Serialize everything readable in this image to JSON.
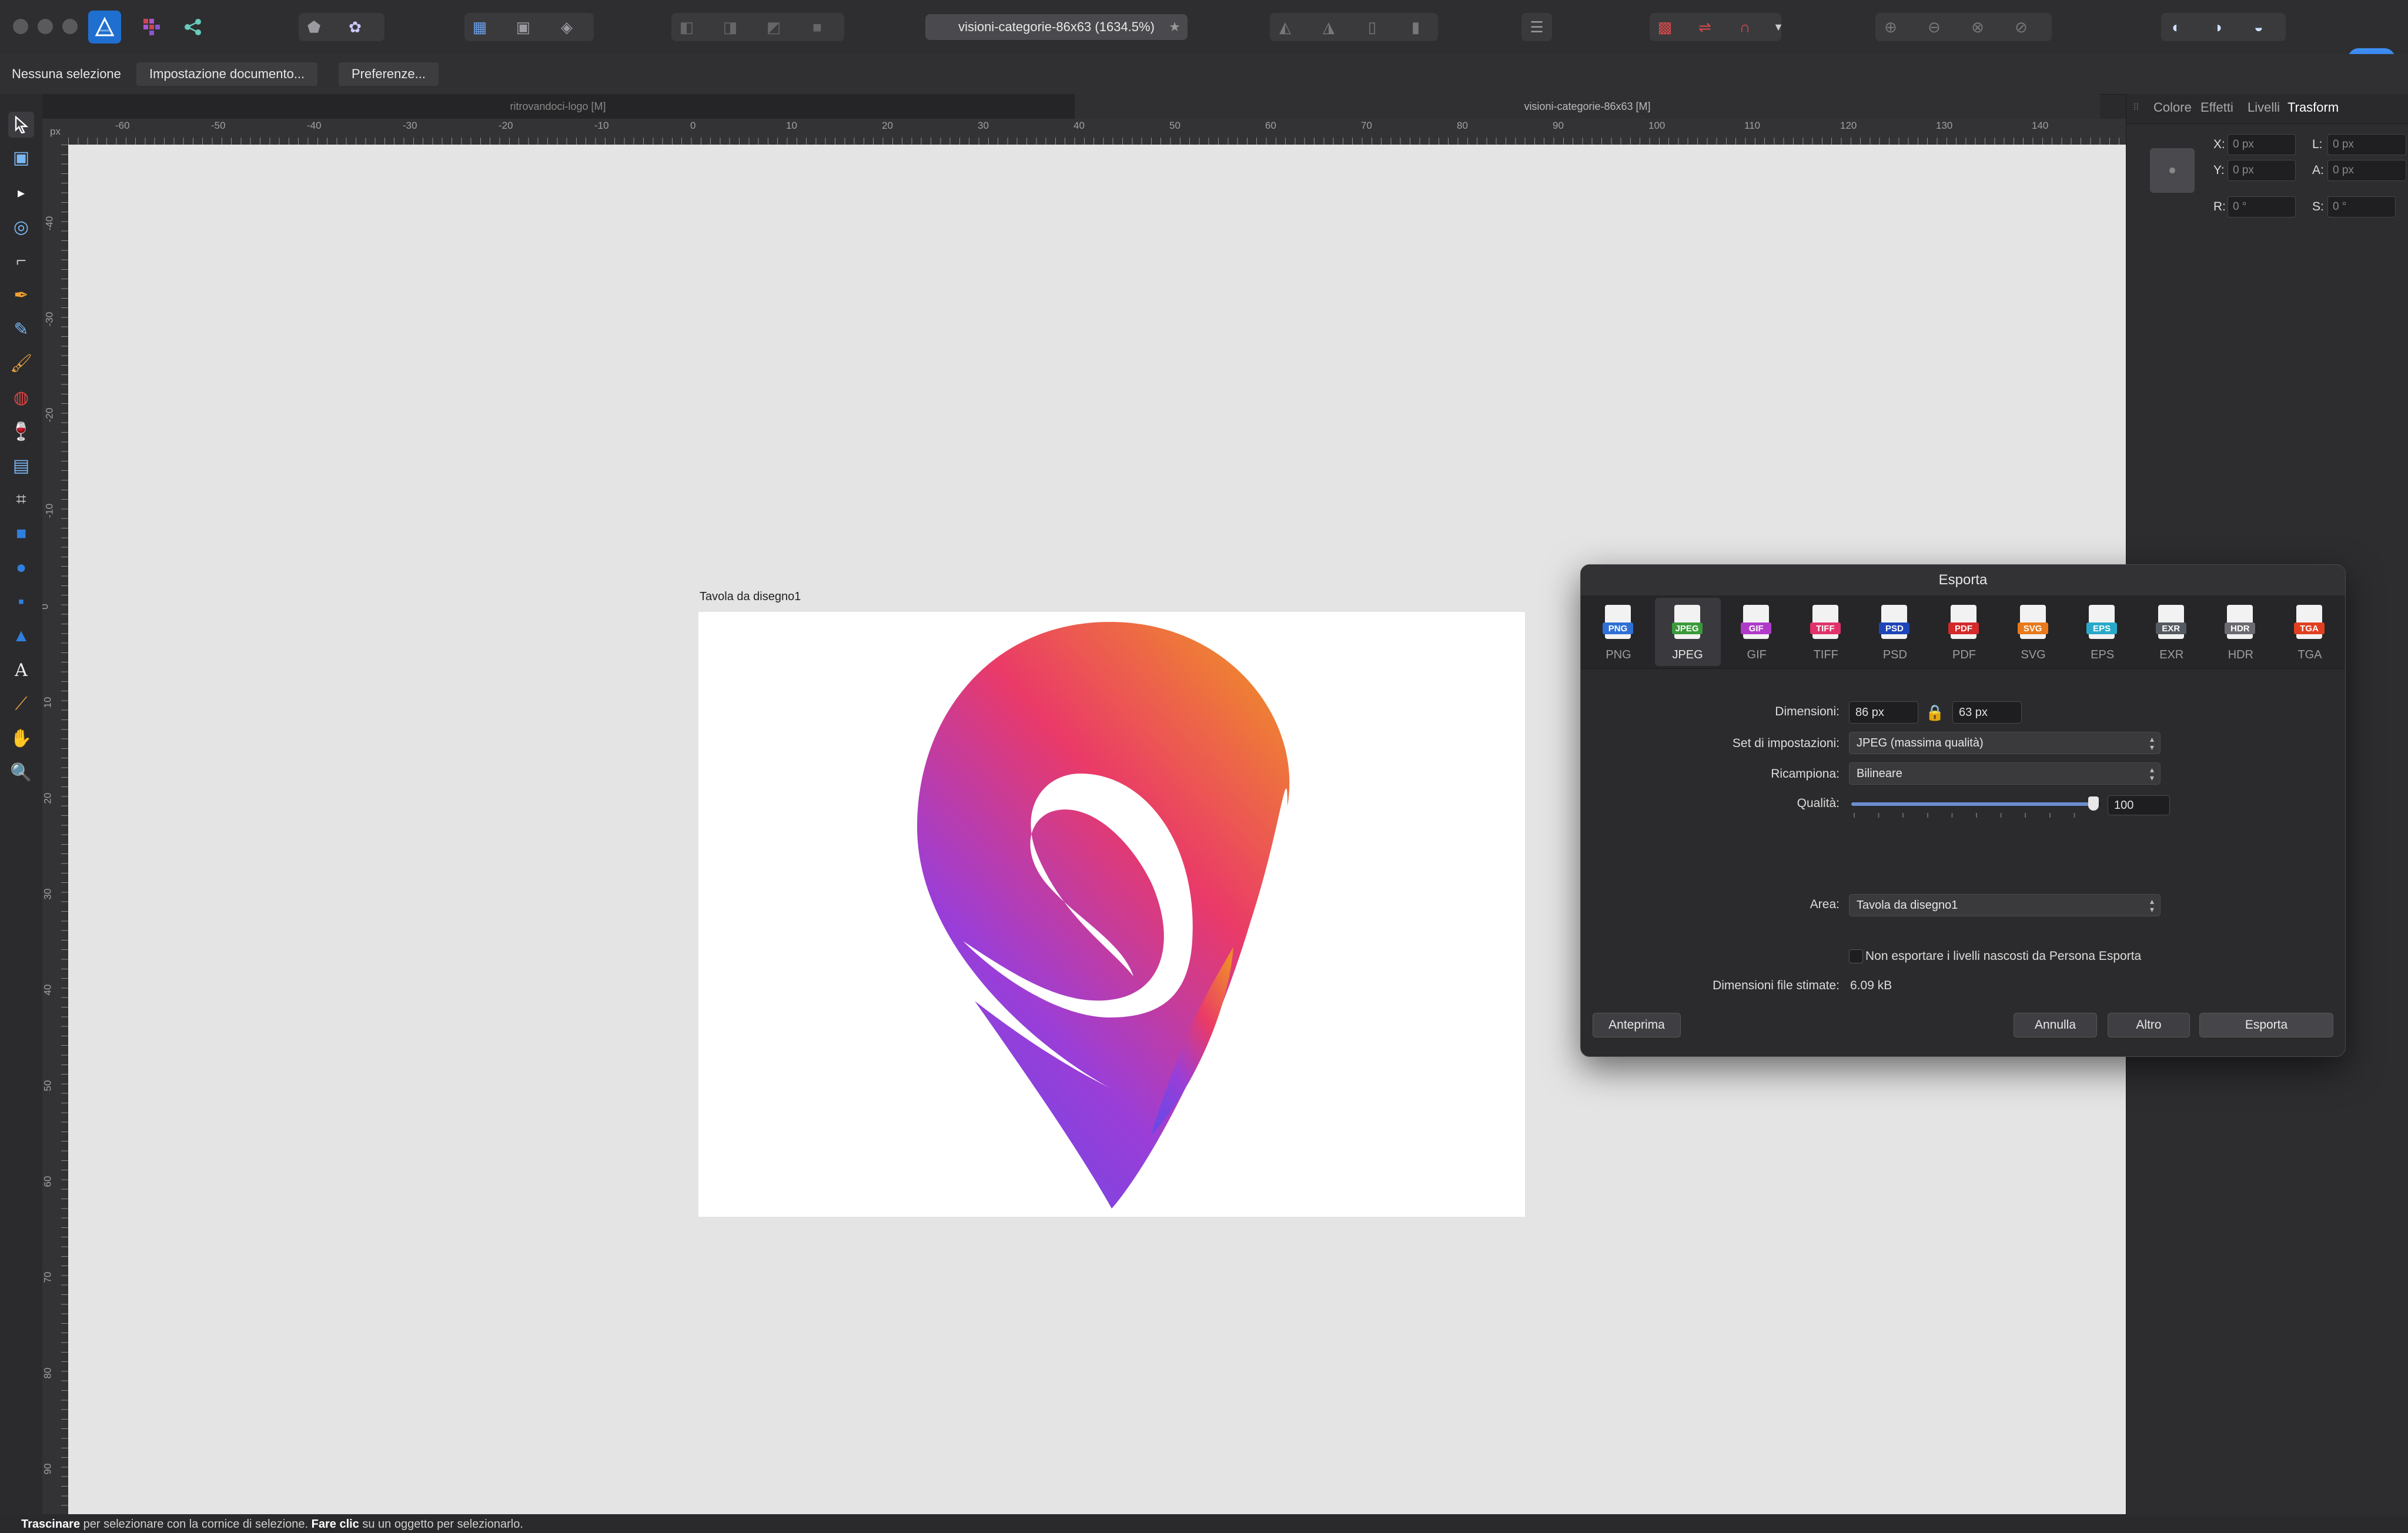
{
  "toolbar": {
    "doc_title": "visioni-categorie-86x63 (1634.5%)",
    "modified_mark": "★"
  },
  "context": {
    "selection": "Nessuna selezione",
    "doc_setup": "Impostazione documento...",
    "prefs": "Preferenze..."
  },
  "tabs": {
    "tab1": "ritrovandoci-logo [M]",
    "tab2": "visioni-categorie-86x63 [M]"
  },
  "ruler": {
    "unit": "px",
    "h_labels": [
      "-60",
      "-50",
      "-40",
      "-30",
      "-20",
      "-10",
      "0",
      "10",
      "20",
      "30",
      "40",
      "50",
      "60",
      "70",
      "80",
      "90",
      "100",
      "110",
      "120",
      "130",
      "140"
    ],
    "v_labels": [
      "-40",
      "-30",
      "-20",
      "-10",
      "0",
      "10",
      "20",
      "30",
      "40",
      "50",
      "60",
      "70",
      "80",
      "90"
    ]
  },
  "artboard": {
    "label": "Tavola da disegno1"
  },
  "right_panel": {
    "tabs": [
      "Colore",
      "Effetti",
      "Livelli",
      "Trasform"
    ],
    "x_label": "X:",
    "x_value": "0 px",
    "y_label": "Y:",
    "y_value": "0 px",
    "w_label": "L:",
    "w_value": "0 px",
    "h_label": "A:",
    "h_value": "0 px",
    "r_label": "R:",
    "r_value": "0 °",
    "s_label": "S:",
    "s_value": "0 °"
  },
  "export": {
    "title": "Esporta",
    "formats": [
      {
        "name": "PNG",
        "color": "#2f6fd6"
      },
      {
        "name": "JPEG",
        "color": "#3a9a3a"
      },
      {
        "name": "GIF",
        "color": "#b03ac8"
      },
      {
        "name": "TIFF",
        "color": "#e0336b"
      },
      {
        "name": "PSD",
        "color": "#1f46b8"
      },
      {
        "name": "PDF",
        "color": "#d42a2a"
      },
      {
        "name": "SVG",
        "color": "#e87a1c"
      },
      {
        "name": "EPS",
        "color": "#29a9c9"
      },
      {
        "name": "EXR",
        "color": "#555a60"
      },
      {
        "name": "HDR",
        "color": "#6a6a70"
      },
      {
        "name": "TGA",
        "color": "#e04020"
      }
    ],
    "selected_format": "JPEG",
    "dimensions_label": "Dimensioni:",
    "width_value": "86 px",
    "height_value": "63 px",
    "preset_label": "Set di impostazioni:",
    "preset_value": "JPEG (massima qualità)",
    "resample_label": "Ricampiona:",
    "resample_value": "Bilineare",
    "quality_label": "Qualità:",
    "quality_value": "100",
    "quality_level": 1.0,
    "area_label": "Area:",
    "area_value": "Tavola da disegno1",
    "hidden_layers_label": "Non esportare i livelli nascosti da Persona Esporta",
    "hidden_layers_checked": false,
    "filesize_label": "Dimensioni file stimate:",
    "filesize_value": "6.09 kB",
    "preview_btn": "Anteprima",
    "cancel_btn": "Annulla",
    "more_btn": "Altro",
    "export_btn": "Esporta"
  },
  "status": {
    "bold1": "Trascinare",
    "text1": " per selezionare con la cornice di selezione. ",
    "bold2": "Fare clic",
    "text2": " su un oggetto per selezionarlo."
  }
}
